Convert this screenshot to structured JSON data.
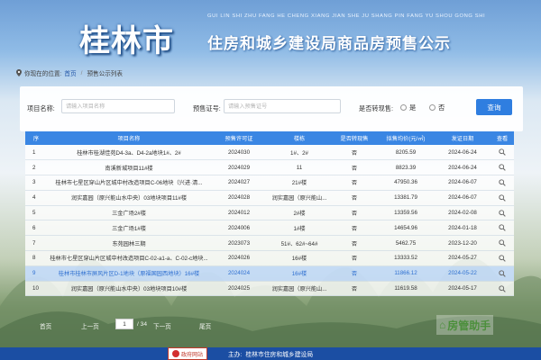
{
  "header": {
    "logo": "桂林市",
    "pinyin": "GUI LIN SHI ZHU FANG HE CHENG XIANG JIAN SHE JU SHANG PIN FANG YU SHOU GONG SHI",
    "headline": "住房和城乡建设局商品房预售公示"
  },
  "breadcrumb": {
    "prefix": "你现在的位置:",
    "home": "首页",
    "separator": "/",
    "current": "预售公示列表"
  },
  "search": {
    "project_label": "项目名称:",
    "project_placeholder": "请输入项目名称",
    "license_label": "预售证号:",
    "license_placeholder": "请输入预售证号",
    "transfer_label": "是否转现售:",
    "option_yes": "是",
    "option_no": "否",
    "button": "查询"
  },
  "table": {
    "headers": [
      "序",
      "项目名称",
      "预售许可证",
      "楼栋",
      "是否转现售",
      "拟售均价(元/㎡)",
      "发证日期",
      "查看"
    ],
    "highlight_row": 8,
    "rows": [
      {
        "seq": "1",
        "name": "桂林市桂湖佳苑D4-3a、D4-2a地块1#、2#",
        "license": "2024030",
        "building": "1#、2#",
        "transfer": "否",
        "price": "8205.59",
        "date": "2024-06-24"
      },
      {
        "seq": "2",
        "name": "南溪新城项目11#楼",
        "license": "2024029",
        "building": "11",
        "transfer": "否",
        "price": "8823.39",
        "date": "2024-06-24"
      },
      {
        "seq": "3",
        "name": "桂林市七星区穿山片区城中村改造项目C-06地块（兴进·清...",
        "license": "2024027",
        "building": "21#楼",
        "transfer": "否",
        "price": "47950.36",
        "date": "2024-06-07"
      },
      {
        "seq": "4",
        "name": "润实嘉园（原兴能山水中央）03地块项目11#楼",
        "license": "2024028",
        "building": "润实嘉园（原兴能山...",
        "transfer": "否",
        "price": "13381.79",
        "date": "2024-06-07"
      },
      {
        "seq": "5",
        "name": "三金广场2#楼",
        "license": "2024012",
        "building": "2#楼",
        "transfer": "否",
        "price": "13359.56",
        "date": "2024-02-08"
      },
      {
        "seq": "6",
        "name": "三金广场1#楼",
        "license": "2024006",
        "building": "1#楼",
        "transfer": "否",
        "price": "14654.96",
        "date": "2024-01-18"
      },
      {
        "seq": "7",
        "name": "东苑园林三期",
        "license": "2023073",
        "building": "51#、62#~64#",
        "transfer": "否",
        "price": "5462.75",
        "date": "2023-12-20"
      },
      {
        "seq": "8",
        "name": "桂林市七星区穿山片区城中村改造项目C-02-a1-a、C-02-c地块...",
        "license": "2024026",
        "building": "16#楼",
        "transfer": "否",
        "price": "13333.52",
        "date": "2024-05-27"
      },
      {
        "seq": "9",
        "name": "桂林市桂林市屏风片区D-1地块（原福国园西地块）16#楼",
        "license": "2024024",
        "building": "16#楼",
        "transfer": "否",
        "price": "11866.12",
        "date": "2024-05-22"
      },
      {
        "seq": "10",
        "name": "润实嘉园（原兴能山水中央）03地块项目10#楼",
        "license": "2024025",
        "building": "润实嘉园（原兴能山...",
        "transfer": "否",
        "price": "11619.58",
        "date": "2024-05-17"
      }
    ]
  },
  "pagination": {
    "first": "首页",
    "prev": "上一页",
    "current_page": "1",
    "total": "/ 34",
    "next": "下一页",
    "last": "尾页"
  },
  "watermark": {
    "icon_text": "⌂",
    "text": "房管助手"
  },
  "footer": {
    "badge": "政府网站",
    "sponsor_label": "主办:",
    "sponsor": "桂林市住房和城乡建设局"
  },
  "colors": {
    "header_blue": "#3a86e3",
    "button_blue": "#2f7ee0",
    "footer_blue": "#1b4ea3",
    "highlight_text": "#2e6fd0"
  }
}
